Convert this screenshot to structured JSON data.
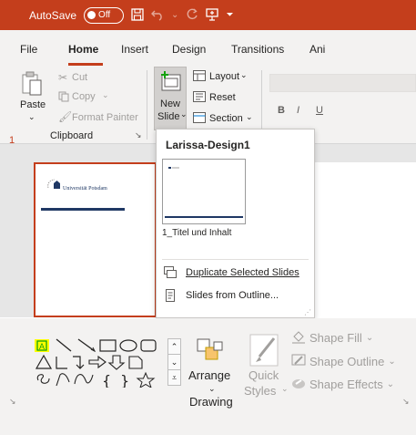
{
  "titlebar": {
    "autosave_label": "AutoSave",
    "toggle_state": "Off"
  },
  "tabs": [
    "File",
    "Home",
    "Insert",
    "Design",
    "Transitions",
    "Ani"
  ],
  "clipboard": {
    "paste": "Paste",
    "cut": "Cut",
    "copy": "Copy",
    "format_painter": "Format Painter",
    "group_label": "Clipboard"
  },
  "slides": {
    "new_slide_line1": "New",
    "new_slide_line2": "Slide",
    "layout": "Layout",
    "reset": "Reset",
    "section": "Section"
  },
  "font_buttons": {
    "bold": "B",
    "italic": "I",
    "underline": "U"
  },
  "thumbnail": {
    "slide_number": "1",
    "university_text": "Universität Potsdam"
  },
  "dropdown": {
    "heading": "Larissa-Design1",
    "layout_name": "1_Titel und Inhalt",
    "duplicate": "Duplicate Selected Slides",
    "from_outline": "Slides from Outline..."
  },
  "drawing": {
    "arrange": "Arrange",
    "quick_styles_line1": "Quick",
    "quick_styles_line2": "Styles",
    "shape_fill": "Shape Fill",
    "shape_outline": "Shape Outline",
    "shape_effects": "Shape Effects",
    "group_label": "Drawing"
  },
  "colors": {
    "accent": "#c43e1c",
    "highlight": "#ffff00",
    "navy": "#1f3864"
  }
}
